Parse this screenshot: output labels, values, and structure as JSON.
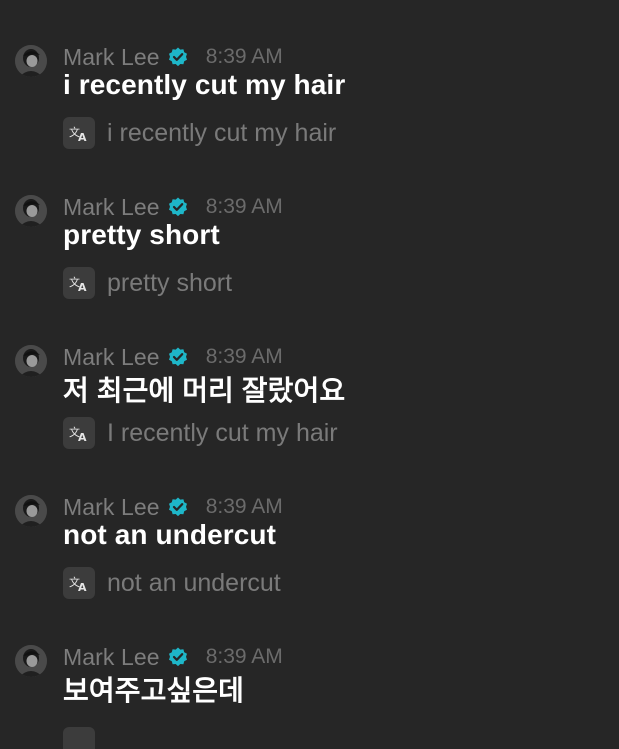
{
  "sender": {
    "name": "Mark Lee",
    "verified_color": "#1eb6c8",
    "avatar_icon": "profile-photo"
  },
  "messages": [
    {
      "time": "8:39 AM",
      "text": "i recently cut my hair",
      "translation": "i recently cut my hair"
    },
    {
      "time": "8:39 AM",
      "text": "pretty short",
      "translation": "pretty short"
    },
    {
      "time": "8:39 AM",
      "text": "저 최근에 머리 잘랐어요",
      "translation": "I recently cut my hair"
    },
    {
      "time": "8:39 AM",
      "text": "not an undercut",
      "translation": "not an undercut"
    },
    {
      "time": "8:39 AM",
      "text": "보여주고싶은데",
      "translation": ""
    }
  ],
  "icons": {
    "translate": "translate-icon",
    "verified": "verified-badge-icon"
  }
}
